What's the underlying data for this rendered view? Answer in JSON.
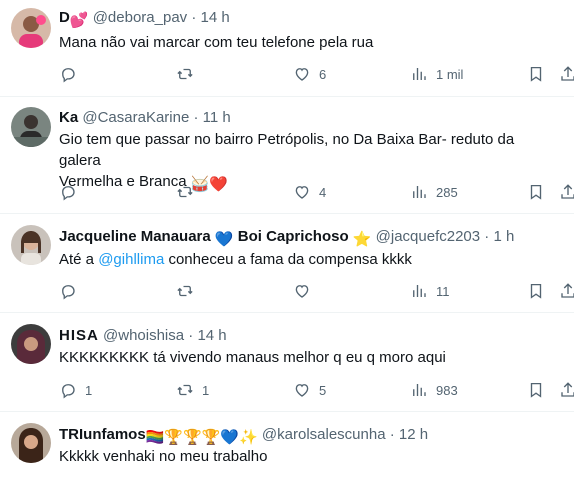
{
  "tweets": [
    {
      "name": "D",
      "name_emoji": "💕",
      "handle": "@debora_pav",
      "time": "14 h",
      "text_parts": [
        "Mana não vai marcar com teu telefone pela rua"
      ],
      "replies": "",
      "retweets": "",
      "likes": "6",
      "views": "1 mil"
    },
    {
      "name": "Ka",
      "handle": "@CasaraKarine",
      "time": "11 h",
      "text_line1": "Gio tem que passar no bairro Petrópolis, no Da Baixa Bar- reduto da galera",
      "text_line2": "Vermelha e Branca",
      "text_emoji": "🥁❤️",
      "replies": "",
      "retweets": "",
      "likes": "4",
      "views": "285"
    },
    {
      "name": "Jacqueline Manauara",
      "name_emoji": "💙",
      "name2": "Boi Caprichoso",
      "name2_emoji": "⭐",
      "handle": "@jacquefc2203",
      "time": "1 h",
      "text_before": "Até a ",
      "text_mention": "@gihllima",
      "text_after": " conheceu a fama da compensa kkkk",
      "replies": "",
      "retweets": "",
      "likes": "",
      "views": "11"
    },
    {
      "name": "HISA",
      "handle": "@whoishisa",
      "time": "14 h",
      "text": "KKKKKKKKK tá vivendo manaus melhor q eu q moro aqui",
      "replies": "1",
      "retweets": "1",
      "likes": "5",
      "views": "983"
    },
    {
      "name": "TRIunfamos",
      "name_emoji": "🏳️‍🌈🏆🏆🏆💙✨",
      "handle": "@karolsalescunha",
      "time": "12 h",
      "text": "Kkkkk venhaki no meu trabalho"
    }
  ],
  "separator": "·",
  "icons": [
    "reply-icon",
    "retweet-icon",
    "like-icon",
    "views-icon",
    "bookmark-icon",
    "share-icon"
  ],
  "colors": {
    "text": "#0f1419",
    "secondary": "#536471",
    "link": "#1d9bf0",
    "divider": "#eff3f4"
  }
}
